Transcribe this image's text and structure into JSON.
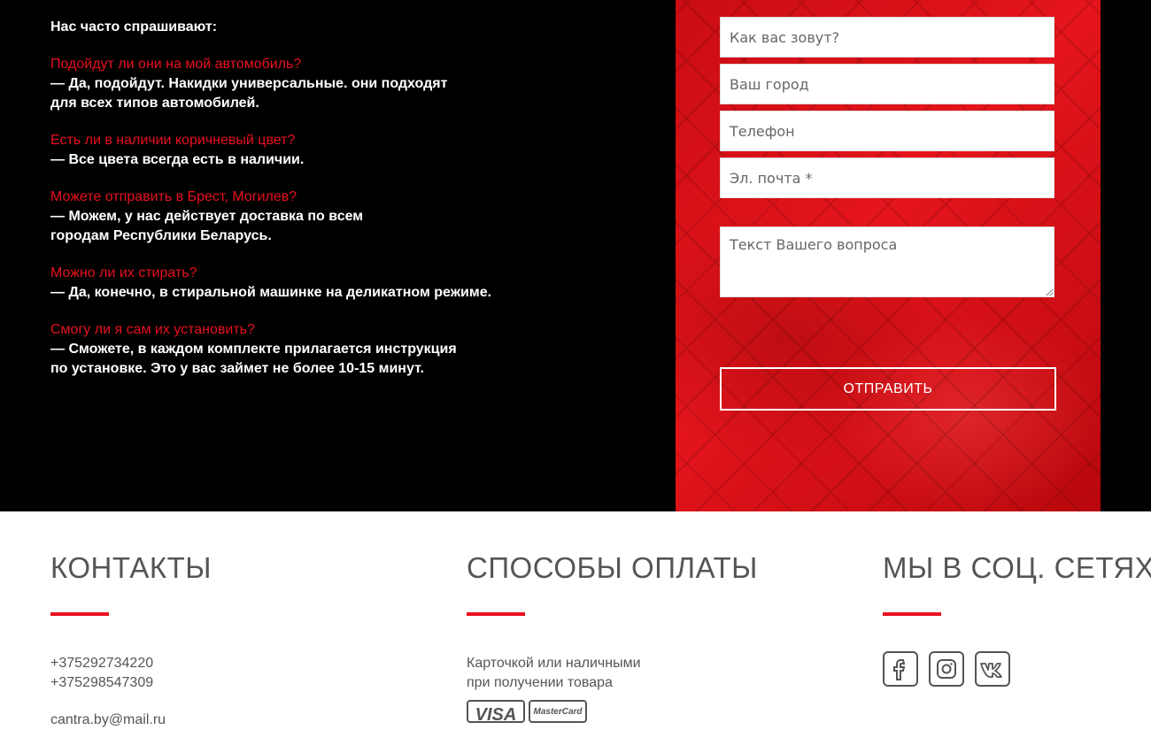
{
  "faq": {
    "heading": "Нас часто спрашивают:",
    "items": [
      {
        "q": "Подойдут ли они на мой автомобиль?",
        "a": "— Да, подойдут. Накидки универсальные. они подходят\nдля всех типов автомобилей."
      },
      {
        "q": "Есть ли в наличии коричневый цвет?",
        "a": "— Все цвета всегда есть в наличии."
      },
      {
        "q": "Можете отправить в Брест, Могилев?",
        "a": "— Можем, у нас действует доставка по всем\nгородам Республики Беларусь."
      },
      {
        "q": "Можно ли их стирать?",
        "a": "— Да, конечно, в стиральной машинке на деликатном режиме."
      },
      {
        "q": "Смогу ли я сам их установить?",
        "a": "— Сможете, в каждом комплекте прилагается инструкция\nпо установке. Это у вас займет не более 10-15 минут."
      }
    ]
  },
  "form": {
    "name_placeholder": "Как вас зовут?",
    "city_placeholder": "Ваш город",
    "phone_placeholder": "Телефон",
    "email_placeholder": "Эл. почта *",
    "question_placeholder": "Текст Вашего вопроса",
    "submit_label": "ОТПРАВИТЬ"
  },
  "footer": {
    "contacts": {
      "title": "КОНТАКТЫ",
      "phone1": "+375292734220",
      "phone2": "+375298547309",
      "email": "cantra.by@mail.ru"
    },
    "payment": {
      "title": "СПОСОБЫ ОПЛАТЫ",
      "text": "Карточкой или наличными\nпри получении товара",
      "logos": [
        "VISA",
        "MasterCard"
      ]
    },
    "social": {
      "title": "МЫ В СОЦ. СЕТЯХ",
      "icons": [
        "facebook-icon",
        "instagram-icon",
        "vk-icon"
      ]
    }
  },
  "colors": {
    "accent": "#e8101f",
    "background_dark": "#000000",
    "footer_text": "#555555"
  }
}
